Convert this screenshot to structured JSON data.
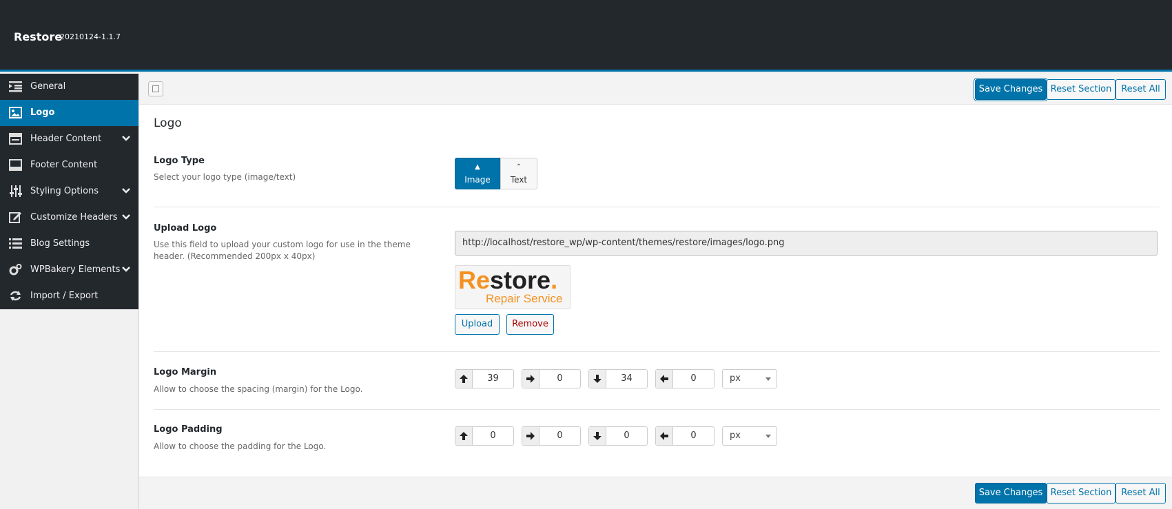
{
  "app": {
    "title": "Restore",
    "version": "20210124-1.1.7"
  },
  "sidebar": {
    "items": [
      {
        "label": "General",
        "icon": "list-indent-icon"
      },
      {
        "label": "Logo",
        "icon": "image-icon",
        "active": true
      },
      {
        "label": "Header Content",
        "icon": "header-icon",
        "expandable": true
      },
      {
        "label": "Footer Content",
        "icon": "footer-icon"
      },
      {
        "label": "Styling Options",
        "icon": "sliders-icon",
        "expandable": true
      },
      {
        "label": "Customize Headers",
        "icon": "edit-icon",
        "expandable": true
      },
      {
        "label": "Blog Settings",
        "icon": "list-icon"
      },
      {
        "label": "WPBakery Elements",
        "icon": "gears-icon",
        "expandable": true
      },
      {
        "label": "Import / Export",
        "icon": "refresh-icon"
      }
    ]
  },
  "toolbar": {
    "save_label": "Save Changes",
    "reset_section_label": "Reset Section",
    "reset_all_label": "Reset All"
  },
  "section": {
    "title": "Logo"
  },
  "fields": {
    "logo_type": {
      "title": "Logo Type",
      "desc": "Select your logo type (image/text)",
      "options": [
        "Image",
        "Text"
      ],
      "selected": "Image"
    },
    "upload_logo": {
      "title": "Upload Logo",
      "desc": "Use this field to upload your custom logo for use in the theme header. (Recommended 200px x 40px)",
      "url": "http://localhost/restore_wp/wp-content/themes/restore/images/logo.png",
      "preview": {
        "brand_re": "Re",
        "brand_rest": "store",
        "brand_dot": ".",
        "tagline": "Repair Service"
      },
      "upload_label": "Upload",
      "remove_label": "Remove"
    },
    "logo_margin": {
      "title": "Logo Margin",
      "desc": "Allow to choose the spacing (margin) for the Logo.",
      "top": "39",
      "right": "0",
      "bottom": "34",
      "left": "0",
      "unit": "px"
    },
    "logo_padding": {
      "title": "Logo Padding",
      "desc": "Allow to choose the padding for the Logo.",
      "top": "0",
      "right": "0",
      "bottom": "0",
      "left": "0",
      "unit": "px"
    }
  },
  "colors": {
    "accent": "#0073aa",
    "dark": "#23282d",
    "logo_orange": "#f39222",
    "danger": "#aa0000"
  }
}
